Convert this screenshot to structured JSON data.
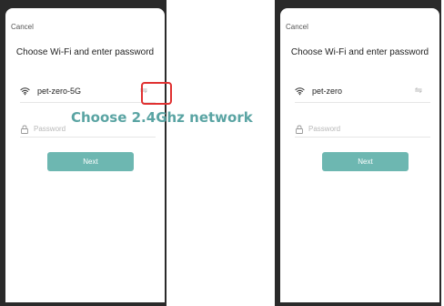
{
  "colors": {
    "accent": "#6db7b1",
    "callout": "#5aa4a3",
    "highlight": "#e03131"
  },
  "screens": [
    {
      "cancel_label": "Cancel",
      "title": "Choose Wi-Fi and enter password",
      "ssid": "pet-zero-5G",
      "password_placeholder": "Password",
      "next_label": "Next",
      "icons": {
        "wifi": "wifi-icon",
        "switch": "switch-network-icon",
        "lock": "lock-icon"
      }
    },
    {
      "cancel_label": "Cancel",
      "title": "Choose Wi-Fi and enter password",
      "ssid": "pet-zero",
      "password_placeholder": "Password",
      "next_label": "Next",
      "icons": {
        "wifi": "wifi-icon",
        "switch": "switch-network-icon",
        "lock": "lock-icon"
      }
    }
  ],
  "annotation": {
    "callout_text": "Choose 2.4Ghz network"
  }
}
